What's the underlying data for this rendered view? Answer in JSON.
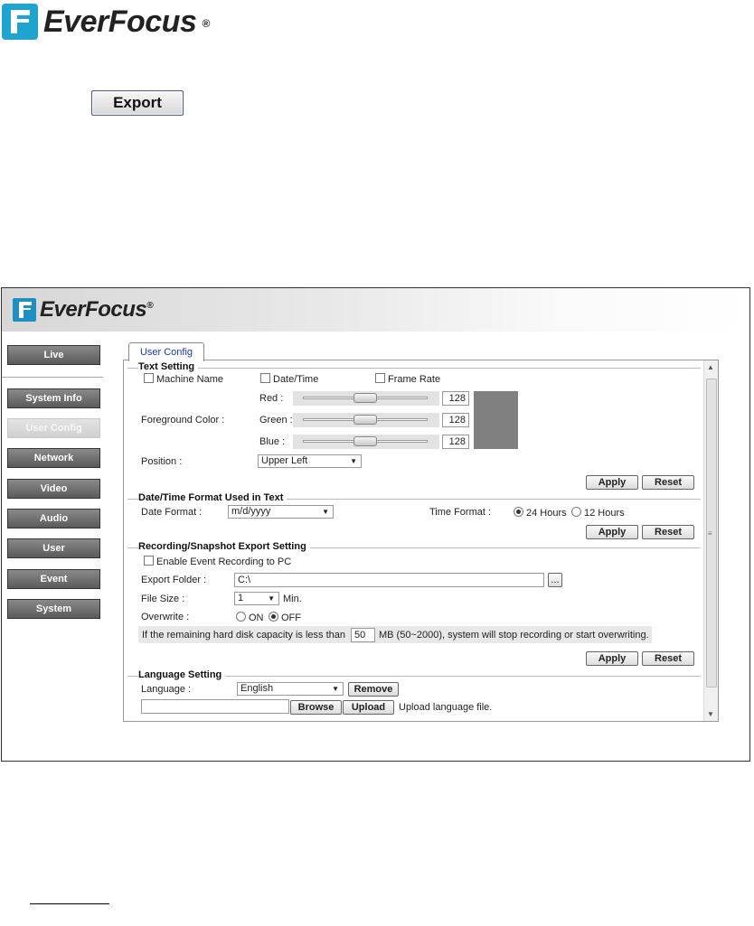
{
  "brand": {
    "name": "EverFocus",
    "reg": "®"
  },
  "export_button": "Export",
  "sidebar": {
    "items": [
      {
        "label": "Live",
        "top": 0
      },
      {
        "label": "System Info",
        "active": false
      },
      {
        "label": "User Config",
        "active": true
      },
      {
        "label": "Network"
      },
      {
        "label": "Video"
      },
      {
        "label": "Audio"
      },
      {
        "label": "User"
      },
      {
        "label": "Event"
      },
      {
        "label": "System"
      }
    ]
  },
  "tab": "User Config",
  "text_setting": {
    "title": "Text Setting",
    "machine_name": "Machine Name",
    "date_time": "Date/Time",
    "frame_rate": "Frame Rate",
    "foreground_color": "Foreground Color :",
    "red_label": "Red :",
    "green_label": "Green :",
    "blue_label": "Blue :",
    "red": "128",
    "green": "128",
    "blue": "128",
    "red_level": 0.5,
    "green_level": 0.5,
    "blue_level": 0.5,
    "swatch_color": "#808080",
    "position_label": "Position :",
    "position_value": "Upper Left"
  },
  "datetime_format": {
    "title": "Date/Time Format Used in Text",
    "date_label": "Date Format :",
    "date_value": "m/d/yyyy",
    "time_label": "Time Format :",
    "opt_24": "24 Hours",
    "opt_12": "12 Hours"
  },
  "recording": {
    "title": "Recording/Snapshot Export Setting",
    "enable": "Enable Event Recording to PC",
    "folder_label": "Export Folder :",
    "folder_value": "C:\\",
    "browse_dots": "...",
    "size_label": "File Size :",
    "size_value": "1",
    "size_unit": "Min.",
    "overwrite_label": "Overwrite :",
    "on": "ON",
    "off": "OFF",
    "hint_pre": "If the remaining hard disk capacity is less than",
    "hint_value": "50",
    "hint_post": "MB (50~2000), system will stop recording or start overwriting."
  },
  "language": {
    "title": "Language Setting",
    "label": "Language :",
    "value": "English",
    "remove": "Remove",
    "browse": "Browse",
    "upload": "Upload",
    "upload_text": "Upload language file."
  },
  "actions": {
    "apply": "Apply",
    "reset": "Reset"
  }
}
